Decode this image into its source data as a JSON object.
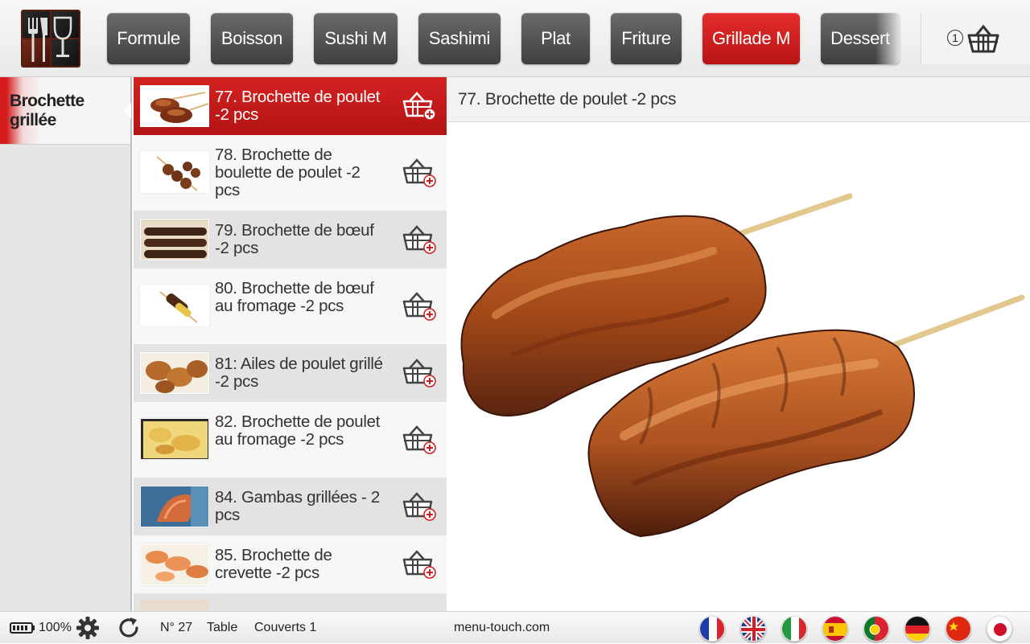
{
  "header": {
    "categories": [
      {
        "label": "Formule"
      },
      {
        "label": "Boisson"
      },
      {
        "label": "Sushi M"
      },
      {
        "label": "Sashimi"
      },
      {
        "label": "Plat"
      },
      {
        "label": "Friture"
      },
      {
        "label": "Grillade M",
        "active": true
      },
      {
        "label": "Dessert"
      }
    ],
    "cart_count": "1",
    "accent_color": "#d41c1c"
  },
  "sidebar": {
    "items": [
      {
        "label": "Brochette grillée",
        "active": true
      }
    ]
  },
  "menu": {
    "items": [
      {
        "label": "77. Brochette de poulet -2 pcs",
        "active": true
      },
      {
        "label": "78. Brochette de boulette de poulet -2 pcs"
      },
      {
        "label": "79. Brochette de bœuf -2 pcs"
      },
      {
        "label": "80. Brochette de bœuf au fromage -2 pcs"
      },
      {
        "label": "81: Ailes de poulet grillé -2 pcs"
      },
      {
        "label": "82. Brochette de poulet au fromage -2 pcs"
      },
      {
        "label": "84. Gambas grillées - 2 pcs"
      },
      {
        "label": "85. Brochette de crevette -2 pcs"
      }
    ]
  },
  "detail": {
    "title": "77. Brochette de poulet -2 pcs"
  },
  "footer": {
    "battery": "100%",
    "table_number": "N° 27",
    "table_label": "Table",
    "covers": "Couverts 1",
    "site": "menu-touch.com",
    "languages": [
      "fr",
      "en",
      "it",
      "es",
      "pt",
      "de",
      "zh",
      "ja"
    ]
  }
}
